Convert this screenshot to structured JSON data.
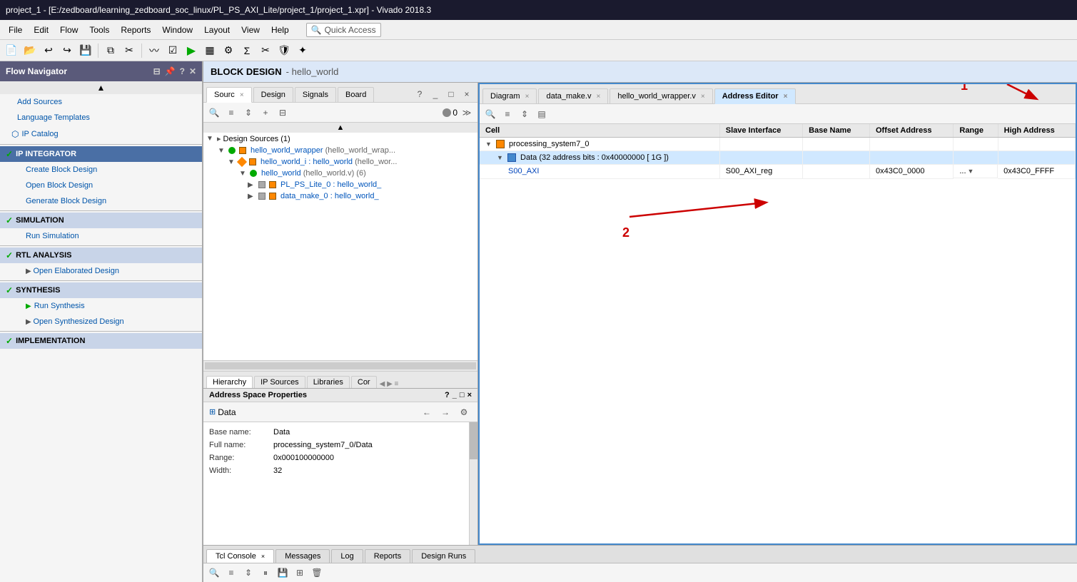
{
  "title_bar": {
    "text": "project_1 - [E:/zedboard/learning_zedboard_soc_linux/PL_PS_AXI_Lite/project_1/project_1.xpr] - Vivado 2018.3"
  },
  "menu_bar": {
    "items": [
      "File",
      "Edit",
      "Flow",
      "Tools",
      "Reports",
      "Window",
      "Layout",
      "View",
      "Help"
    ],
    "quick_access": "Quick Access"
  },
  "flow_navigator": {
    "header": "Flow Navigator",
    "sections": [
      {
        "name": "add_sources",
        "label": "Add Sources",
        "indent": 1
      },
      {
        "name": "language_templates",
        "label": "Language Templates",
        "indent": 1
      },
      {
        "name": "ip_catalog",
        "label": "IP Catalog",
        "indent": 1,
        "has_icon": true
      },
      {
        "name": "ip_integrator",
        "label": "IP INTEGRATOR",
        "is_section": true,
        "active": true
      },
      {
        "name": "create_block_design",
        "label": "Create Block Design",
        "indent": 2
      },
      {
        "name": "open_block_design",
        "label": "Open Block Design",
        "indent": 2
      },
      {
        "name": "generate_block_design",
        "label": "Generate Block Design",
        "indent": 2
      },
      {
        "name": "simulation",
        "label": "SIMULATION",
        "is_section": true
      },
      {
        "name": "run_simulation",
        "label": "Run Simulation",
        "indent": 2
      },
      {
        "name": "rtl_analysis",
        "label": "RTL ANALYSIS",
        "is_section": true
      },
      {
        "name": "open_elaborated_design",
        "label": "Open Elaborated Design",
        "indent": 2
      },
      {
        "name": "synthesis",
        "label": "SYNTHESIS",
        "is_section": true
      },
      {
        "name": "run_synthesis",
        "label": "Run Synthesis",
        "indent": 2,
        "has_run_icon": true
      },
      {
        "name": "open_synthesized_design",
        "label": "Open Synthesized Design",
        "indent": 2
      },
      {
        "name": "implementation",
        "label": "IMPLEMENTATION",
        "is_section": true
      }
    ]
  },
  "block_design_header": {
    "prefix": "BLOCK DESIGN",
    "suffix": "- hello_world"
  },
  "sources_panel": {
    "tabs": [
      {
        "label": "Sourc",
        "active": true,
        "closeable": true
      },
      {
        "label": "Design",
        "active": false
      },
      {
        "label": "Signals",
        "active": false
      },
      {
        "label": "Board",
        "active": false
      }
    ],
    "section_label": "Design Sources (1)",
    "tree": [
      {
        "level": 0,
        "text": "Design Sources (1)",
        "expandable": true,
        "expanded": true
      },
      {
        "level": 1,
        "text": "hello_world_wrapper (hello_world_wrap...",
        "has_circle_green": true,
        "has_sq_orange": true
      },
      {
        "level": 2,
        "text": "hello_world_i : hello_world (hello_wor...",
        "has_diamond": true,
        "has_sq_orange": true
      },
      {
        "level": 3,
        "text": "hello_world (hello_world.v) (6)",
        "has_circle_green": true
      },
      {
        "level": 4,
        "text": "PL_PS_Lite_0 : hello_world_",
        "expandable": true,
        "has_sq_gray": true,
        "has_sq_orange": true
      },
      {
        "level": 4,
        "text": "data_make_0 : hello_world_",
        "expandable": true,
        "has_sq_gray": true,
        "has_sq_orange": true
      }
    ],
    "bottom_tabs": [
      {
        "label": "Hierarchy",
        "active": true
      },
      {
        "label": "IP Sources",
        "active": false
      },
      {
        "label": "Libraries",
        "active": false
      },
      {
        "label": "Cor",
        "active": false
      }
    ]
  },
  "address_space_panel": {
    "title": "Address Space Properties",
    "section_label": "Data",
    "fields": [
      {
        "label": "Base name:",
        "value": "Data"
      },
      {
        "label": "Full name:",
        "value": "processing_system7_0/Data"
      },
      {
        "label": "Range:",
        "value": "0x000100000000"
      },
      {
        "label": "Width:",
        "value": "32"
      }
    ]
  },
  "address_editor": {
    "tabs": [
      {
        "label": "Diagram",
        "closeable": true
      },
      {
        "label": "data_make.v",
        "closeable": true
      },
      {
        "label": "hello_world_wrapper.v",
        "closeable": true
      },
      {
        "label": "Address Editor",
        "active": true,
        "closeable": true
      }
    ],
    "table": {
      "columns": [
        "Cell",
        "Slave Interface",
        "Base Name",
        "Offset Address",
        "Range",
        "High Address"
      ],
      "rows": [
        {
          "type": "section",
          "indent": 0,
          "cell": "processing_system7_0",
          "slave_interface": "",
          "base_name": "",
          "offset": "",
          "range": "",
          "high": ""
        },
        {
          "type": "subsection",
          "indent": 1,
          "cell": "Data (32 address bits : 0x40000000 [ 1G ])",
          "slave_interface": "",
          "base_name": "",
          "offset": "",
          "range": "",
          "high": "",
          "highlighted": true
        },
        {
          "type": "data",
          "indent": 2,
          "cell": "S00_AXI",
          "slave_interface": "S00_AXI_reg",
          "base_name": "",
          "offset": "0x43C0_0000",
          "range": "...",
          "high": "0x43C0_FFFF"
        }
      ]
    },
    "annotation_1": "1",
    "annotation_2": "2"
  },
  "bottom_pane": {
    "tabs": [
      {
        "label": "Tcl Console",
        "active": true,
        "closeable": true
      },
      {
        "label": "Messages",
        "active": false
      },
      {
        "label": "Log",
        "active": false
      },
      {
        "label": "Reports",
        "active": false
      },
      {
        "label": "Design Runs",
        "active": false
      }
    ]
  }
}
